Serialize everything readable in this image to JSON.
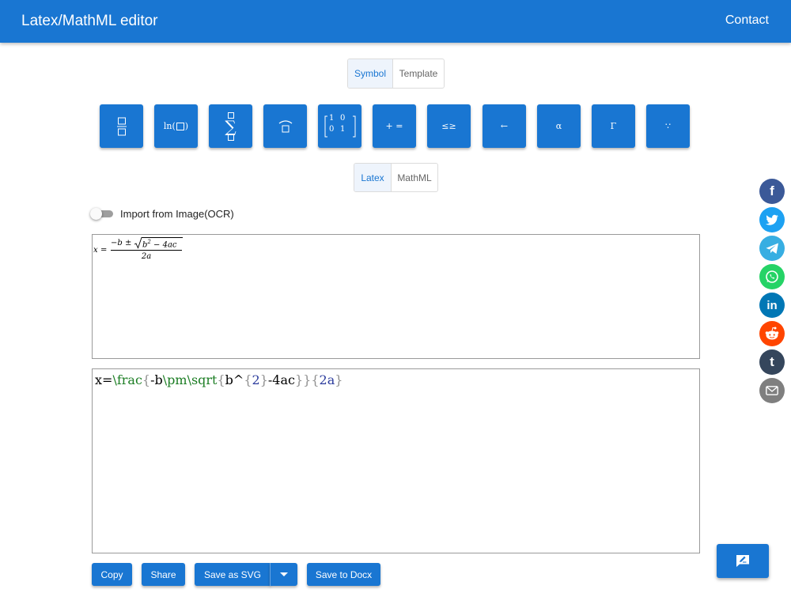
{
  "app": {
    "title": "Latex/MathML editor",
    "contact": "Contact"
  },
  "palette_tabs": [
    {
      "label": "Symbol",
      "active": true
    },
    {
      "label": "Template",
      "active": false
    }
  ],
  "symbols": {
    "log_label": "ln(",
    "log_close": ")",
    "sum_sign": "∑",
    "matrix": [
      "1",
      "0",
      "0",
      "1"
    ],
    "relation": "+ =",
    "inequality": "≤≥",
    "arrow": "←",
    "greek_lower": "α",
    "greek_upper": "Γ",
    "dots": "∵"
  },
  "format_tabs": [
    {
      "label": "Latex",
      "active": true
    },
    {
      "label": "MathML",
      "active": false
    }
  ],
  "ocr": {
    "label": "Import from Image(OCR)",
    "enabled": false
  },
  "preview": {
    "lhs": "x",
    "eq": "=",
    "numerator_pre": "−b ± ",
    "radicand_base": "b",
    "radicand_exp": "2",
    "radicand_rest": " − 4ac",
    "denominator": "2a"
  },
  "editor": {
    "tokens": [
      {
        "text": "x=",
        "kind": "plain"
      },
      {
        "text": "\\frac",
        "kind": "cmd"
      },
      {
        "text": "{",
        "kind": "brace"
      },
      {
        "text": "-b",
        "kind": "plain"
      },
      {
        "text": "\\pm",
        "kind": "cmd"
      },
      {
        "text": "\\sqrt",
        "kind": "cmd"
      },
      {
        "text": "{",
        "kind": "brace"
      },
      {
        "text": "b^",
        "kind": "plain"
      },
      {
        "text": "{",
        "kind": "brace"
      },
      {
        "text": "2",
        "kind": "num"
      },
      {
        "text": "}",
        "kind": "brace"
      },
      {
        "text": "-4ac",
        "kind": "plain"
      },
      {
        "text": "}",
        "kind": "brace"
      },
      {
        "text": "}",
        "kind": "brace"
      },
      {
        "text": "{",
        "kind": "brace"
      },
      {
        "text": "2a",
        "kind": "num"
      },
      {
        "text": "}",
        "kind": "brace"
      }
    ]
  },
  "actions": {
    "copy": "Copy",
    "share": "Share",
    "save_svg": "Save as SVG",
    "save_docx": "Save to Docx"
  },
  "share_icons": [
    {
      "name": "facebook-icon",
      "color": "#3b5998",
      "glyph": "f"
    },
    {
      "name": "twitter-icon",
      "color": "#1da1f2",
      "glyph": ""
    },
    {
      "name": "telegram-icon",
      "color": "#37aee2",
      "glyph": ""
    },
    {
      "name": "whatsapp-icon",
      "color": "#25d366",
      "glyph": ""
    },
    {
      "name": "linkedin-icon",
      "color": "#0077b5",
      "glyph": "in"
    },
    {
      "name": "reddit-icon",
      "color": "#ff4500",
      "glyph": ""
    },
    {
      "name": "tumblr-icon",
      "color": "#35465c",
      "glyph": "t"
    },
    {
      "name": "email-icon",
      "color": "#7f7f7f",
      "glyph": ""
    }
  ],
  "colors": {
    "primary": "#1976d2",
    "cmd": "#1b7d23",
    "brace": "#8f8f8f",
    "num": "#2a3a9c"
  }
}
